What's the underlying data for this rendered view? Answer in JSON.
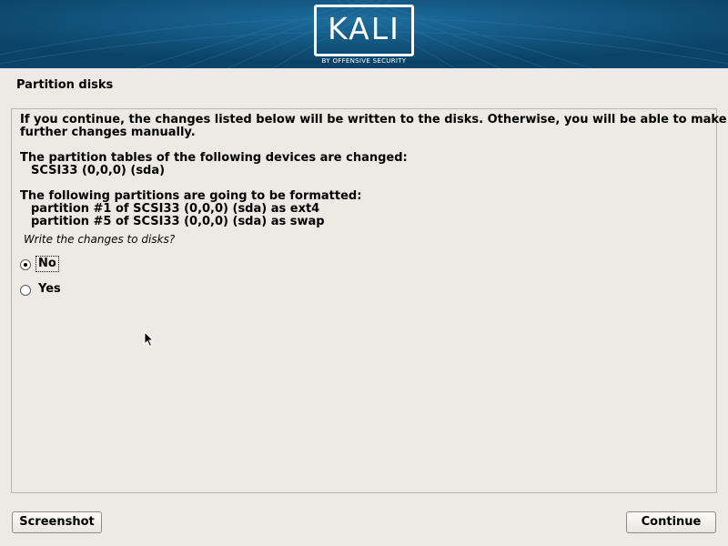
{
  "header": {
    "logo_text": "KALI",
    "logo_subtitle": "BY OFFENSIVE SECURITY",
    "banner_color": "#0e4f7a"
  },
  "page": {
    "title": "Partition disks"
  },
  "content": {
    "intro_line1": "If you continue, the changes listed below will be written to the disks. Otherwise, you will be able to make",
    "intro_line2": "further changes manually.",
    "tables_heading": "The partition tables of the following devices are changed:",
    "tables_device": "SCSI33 (0,0,0) (sda)",
    "format_heading": "The following partitions are going to be formatted:",
    "format_items": [
      "partition #1 of SCSI33 (0,0,0) (sda) as ext4",
      "partition #5 of SCSI33 (0,0,0) (sda) as swap"
    ],
    "question": "Write the changes to disks?"
  },
  "options": [
    {
      "label": "No",
      "selected": true
    },
    {
      "label": "Yes",
      "selected": false
    }
  ],
  "buttons": {
    "screenshot": "Screenshot",
    "continue": "Continue"
  }
}
